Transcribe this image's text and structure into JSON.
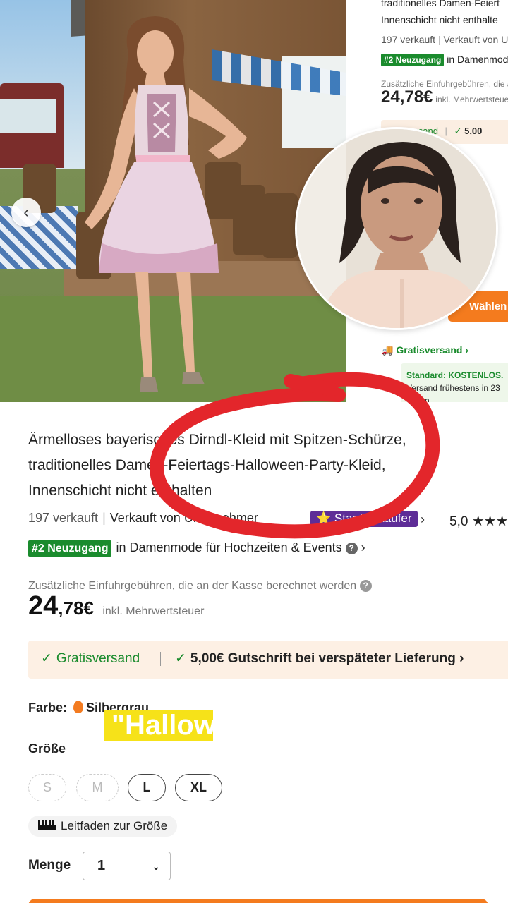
{
  "product": {
    "title": "Ärmelloses bayerisches Dirndl-Kleid mit Spitzen-Schürze, traditionelles Damen-Feiertags-Halloween-Party-Kleid, Innenschicht nicht enthalten",
    "sold": "197 verkauft",
    "sold_by": "Verkauft von Unternehmer",
    "star_seller": "Star-Verkäufer",
    "rating": "5,0",
    "rank_badge": "#2 Neuzugang",
    "rank_text": "in Damenmode für Hochzeiten & Events",
    "import_note": "Zusätzliche Einfuhrgebühren, die an der Kasse berechnet werden",
    "price_main": "24",
    "price_cents": ",78€",
    "price_tax": "inkl. Mehrwertsteuer",
    "free_shipping": "Gratisversand",
    "late_credit": "5,00€ Gutschrift bei verspäteter Lieferung",
    "color_label": "Farbe:",
    "color_value": "Silbergrau",
    "size_label": "Größe",
    "sizes": [
      "S",
      "M",
      "L",
      "XL"
    ],
    "size_guide": "Leitfaden zur Größe",
    "qty_label": "Menge",
    "qty_value": "1"
  },
  "right_panel": {
    "title_line1": "traditionelles Damen-Feiert",
    "title_line2": "Innenschicht nicht enthalte",
    "sold": "197 verkauft",
    "sold_by": "Verkauft von Un",
    "rank_badge": "#2 Neuzugang",
    "rank_text": "in Damenmode",
    "import_note": "Zusätzliche Einfuhrgebühren, die a",
    "price": "24,78€",
    "price_tax": "inkl. Mehrwertsteuer",
    "free_shipping": "Gratisversand",
    "credit": "5,00",
    "choose": "Wählen",
    "shipping_link": "Gratisversand",
    "standard_label": "Standard: KOSTENLOS.",
    "standard_text": "Versand frühestens in 23",
    "standard_text2": "Tagen"
  },
  "caption": "\"Hallow",
  "colors": {
    "accent_orange": "#f47b1e",
    "green": "#1a8b2d",
    "star_purple": "#5e2d97",
    "marker_red": "#e3262b",
    "caption_yellow": "#f6e219"
  }
}
